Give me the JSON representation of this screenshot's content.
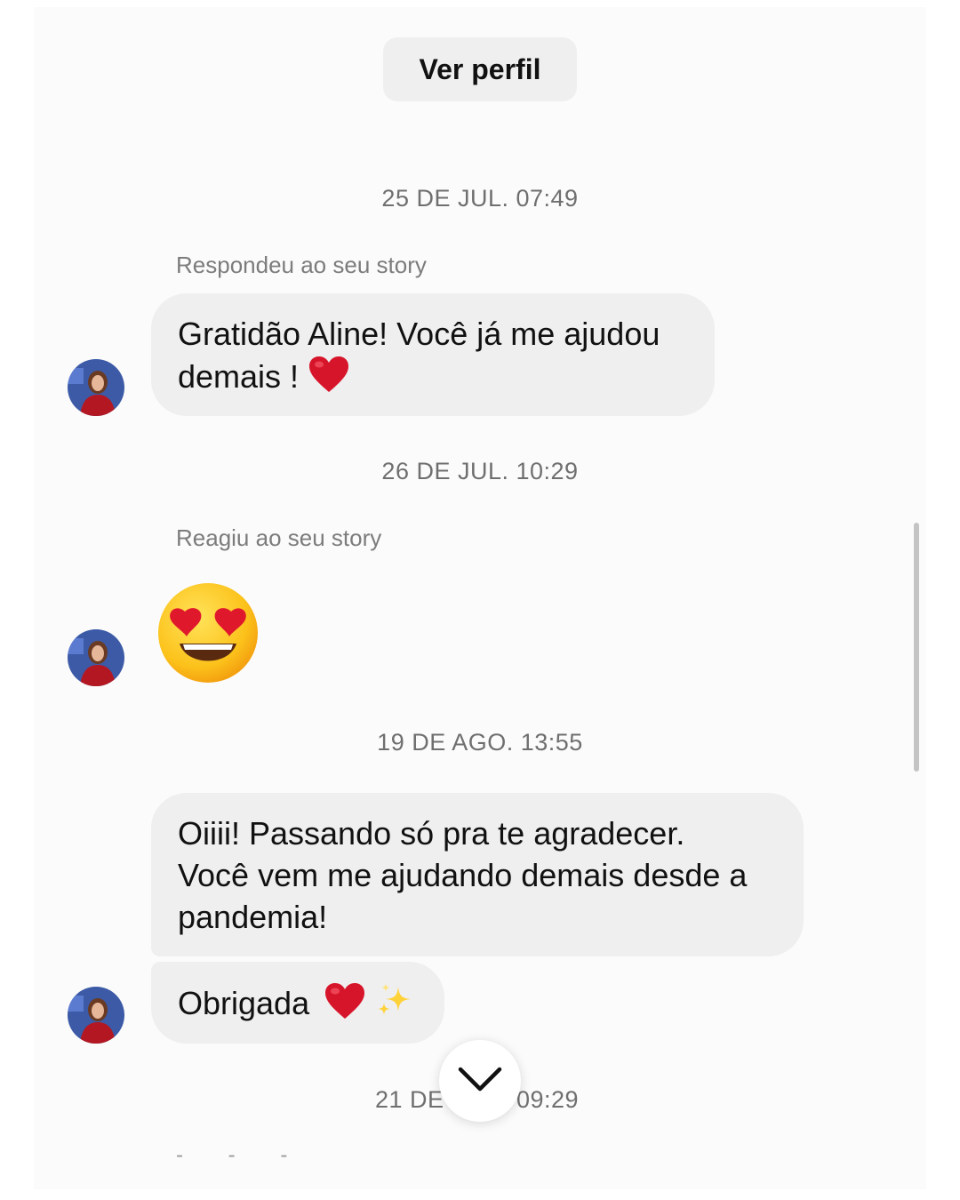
{
  "header": {
    "view_profile_label": "Ver perfil"
  },
  "messages": [
    {
      "timestamp": "25 DE JUL. 07:49",
      "context": "Respondeu ao seu story",
      "line1": "Gratidão Aline! Você já me ajudou",
      "line2": "demais !",
      "emoji": "red-heart"
    },
    {
      "timestamp": "26 DE JUL. 10:29",
      "context": "Reagiu ao seu story",
      "emoji": "smiling-face-with-heart-eyes"
    },
    {
      "timestamp": "19 DE AGO. 13:55",
      "line1": "Oiiii! Passando só pra te agradecer.",
      "line2": "Você vem me ajudando demais desde a",
      "line3": "pandemia!"
    },
    {
      "text": "Obrigada",
      "emoji": [
        "red-heart",
        "sparkles"
      ]
    }
  ],
  "last_timestamp": {
    "left": "21 DE",
    "right": "09:29"
  },
  "colors": {
    "bubble": "#efefef",
    "background": "#fbfbfb",
    "timestamp": "#6f6f6f",
    "heart": "#d7152a"
  }
}
